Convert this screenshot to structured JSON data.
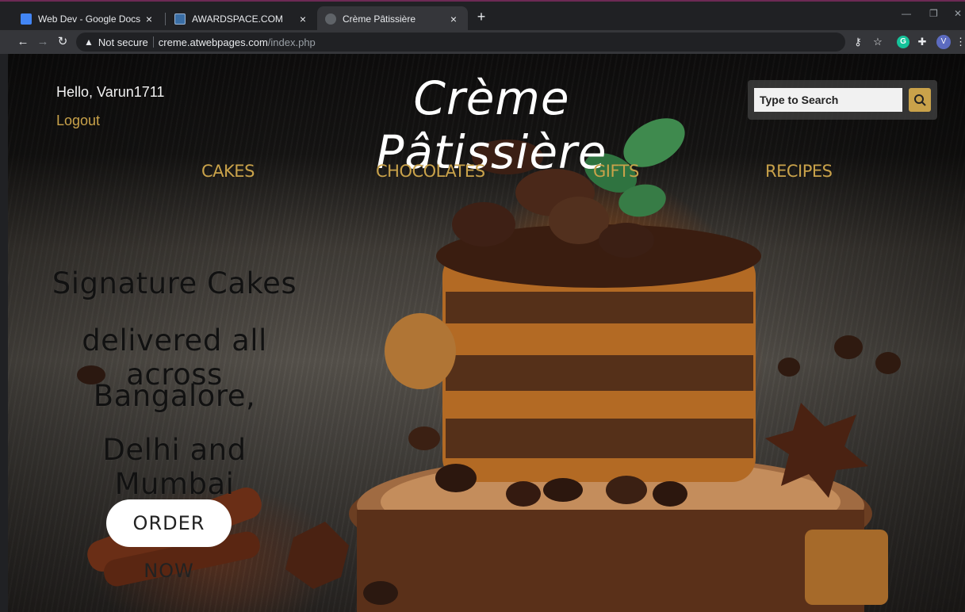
{
  "browser": {
    "tabs": [
      {
        "title": "Web Dev - Google Docs",
        "icon": "google-docs-icon",
        "active": false
      },
      {
        "title": "AWARDSPACE.COM",
        "icon": "awardspace-icon",
        "active": false
      },
      {
        "title": "Crème Pâtissière",
        "icon": "globe-icon",
        "active": true
      }
    ],
    "close_glyph": "×",
    "new_tab_glyph": "+",
    "address": {
      "security_label": "Not secure",
      "host": "creme.atwebpages.com",
      "path": "/index.php"
    },
    "profile_initial": "V",
    "extension_initial": "G"
  },
  "page": {
    "greeting": "Hello, Varun1711",
    "logout_label": "Logout",
    "brand": "Crème Pâtissière",
    "search": {
      "placeholder": "Type to Search"
    },
    "nav": [
      "CAKES",
      "CHOCOLATES",
      "GIFTS",
      "RECIPES"
    ],
    "hero_lines": [
      "Signature Cakes",
      "delivered all across",
      "Bangalore,",
      "Delhi and Mumbai"
    ],
    "order_button": "ORDER NOW",
    "colors": {
      "accent": "#c9a24a",
      "heading": "#ffffff",
      "hero_text": "#111111"
    }
  }
}
